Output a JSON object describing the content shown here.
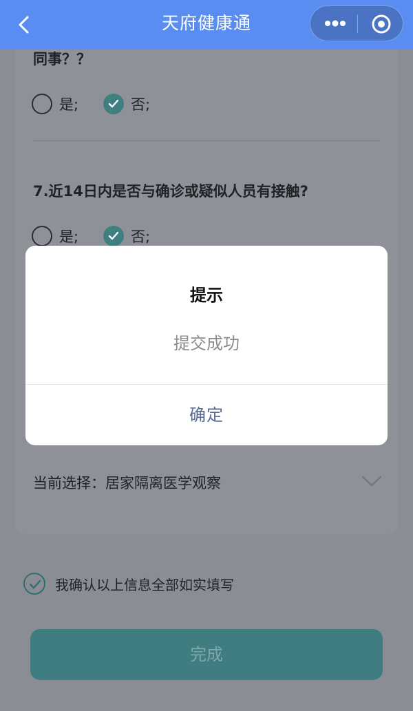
{
  "header": {
    "title": "天府健康通",
    "back_icon": "chevron-left-icon",
    "more_icon": "more-dots-icon",
    "close_icon": "close-target-icon"
  },
  "questions": [
    {
      "text_fragment": "同事？？",
      "options": [
        {
          "label": "是;",
          "checked": false
        },
        {
          "label": "否;",
          "checked": true
        }
      ]
    },
    {
      "text": "7.近14日内是否与确诊或疑似人员有接触?",
      "options": [
        {
          "label": "是;",
          "checked": false
        },
        {
          "label": "否;",
          "checked": true
        }
      ]
    }
  ],
  "status_select": {
    "value": "当前选择：居家隔离医学观察"
  },
  "confirm": {
    "text": "我确认以上信息全部如实填写",
    "checked": true
  },
  "done_button": "完成",
  "modal": {
    "title": "提示",
    "message": "提交成功",
    "ok_label": "确定"
  },
  "colors": {
    "navbar": "#5a8df2",
    "accent_teal": "#3f7f82",
    "modal_button_text": "#586b92"
  }
}
